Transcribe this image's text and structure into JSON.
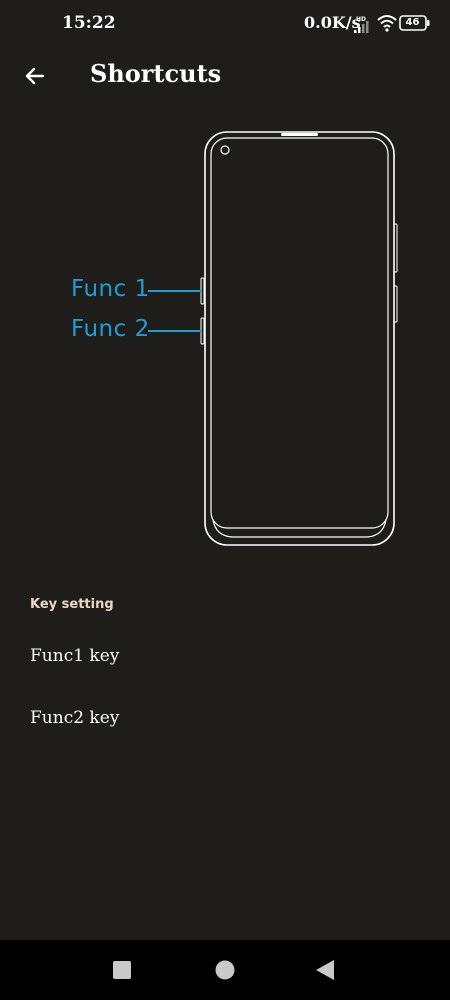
{
  "status_bar": {
    "time": "15:22",
    "network_speed": "0.0K/s",
    "battery_level": "46",
    "icons": [
      "hd-signal-icon",
      "wifi-icon",
      "battery-icon"
    ]
  },
  "app_bar": {
    "title": "Shortcuts",
    "back_icon": "arrow-left-icon"
  },
  "illustration": {
    "func1_label": "Func 1",
    "func2_label": "Func 2",
    "accent_color": "#1e9dd6"
  },
  "key_setting": {
    "header": "Key setting",
    "items": [
      {
        "label": "Func1 key"
      },
      {
        "label": "Func2 key"
      }
    ]
  },
  "nav_bar": {
    "buttons": [
      "recents-square-icon",
      "home-circle-icon",
      "back-triangle-icon"
    ]
  },
  "colors": {
    "background": "#1f1d1a",
    "header_text": "#ead8c4",
    "nav_background": "#000000"
  }
}
